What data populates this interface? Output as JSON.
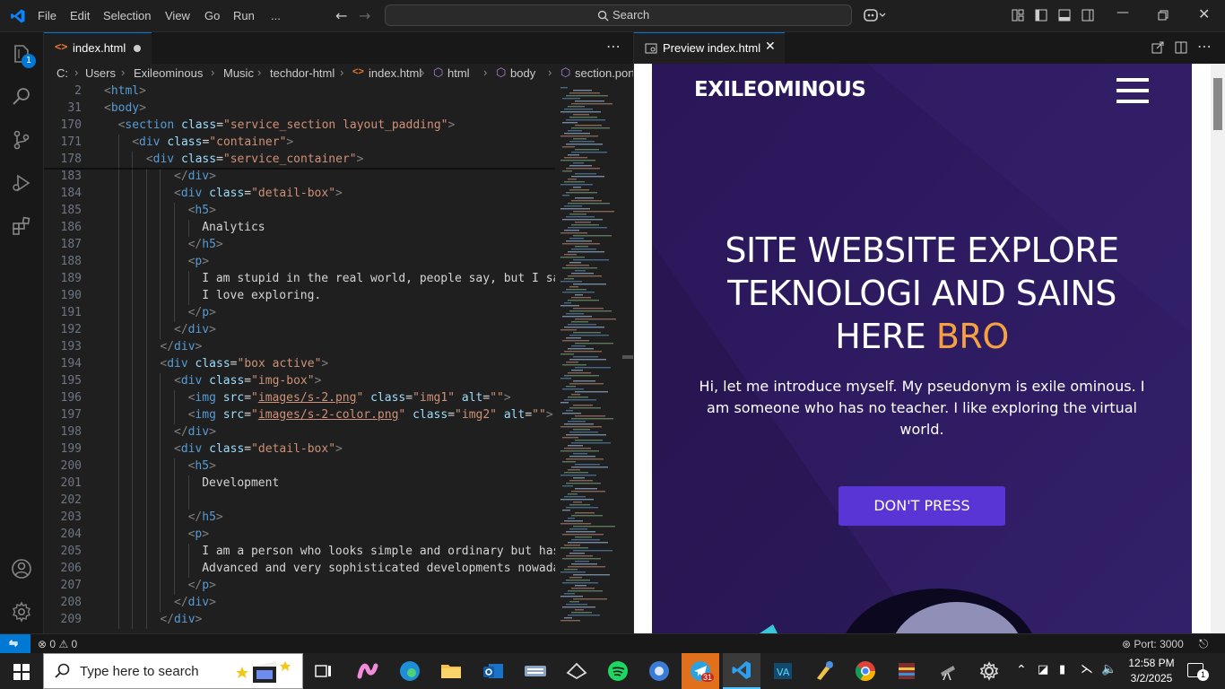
{
  "menu": [
    "File",
    "Edit",
    "Selection",
    "View",
    "Go",
    "Run",
    "..."
  ],
  "search": {
    "label": "Search"
  },
  "badge_count": "1",
  "editor_tab": {
    "title": "index.html"
  },
  "preview_tab": {
    "title": "Preview index.html"
  },
  "breadcrumbs": [
    "C:",
    "Users",
    "Exileominous",
    "Music",
    "techdor-html",
    "index.html",
    "html",
    "body",
    "section.portfolio"
  ],
  "sticky_lines": [
    {
      "n": "2",
      "indent": 0,
      "parts": [
        [
          "punc",
          "<"
        ],
        [
          "tag",
          "html"
        ],
        [
          "punc",
          ">"
        ]
      ]
    },
    {
      "n": "31",
      "indent": 0,
      "parts": [
        [
          "punc",
          "<"
        ],
        [
          "tag",
          "body"
        ],
        [
          "punc",
          ">"
        ]
      ]
    },
    {
      "n": "170",
      "indent": 1,
      "parts": [
        [
          "punc",
          "<"
        ],
        [
          "tag",
          "section"
        ],
        [
          "txt",
          " "
        ],
        [
          "attr",
          "class"
        ],
        [
          "txt",
          "="
        ],
        [
          "str",
          "\"service_section layout_padding\""
        ],
        [
          "punc",
          ">"
        ]
      ]
    },
    {
      "n": "171",
      "indent": 2,
      "parts": [
        [
          "punc",
          "<"
        ],
        [
          "tag",
          "div"
        ],
        [
          "txt",
          " "
        ],
        [
          "attr",
          "class"
        ],
        [
          "txt",
          "="
        ],
        [
          "str",
          "\"container\""
        ],
        [
          "punc",
          ">"
        ]
      ]
    },
    {
      "n": "178",
      "indent": 3,
      "parts": [
        [
          "punc",
          "<"
        ],
        [
          "tag",
          "div"
        ],
        [
          "txt",
          " "
        ],
        [
          "attr",
          "class"
        ],
        [
          "txt",
          "="
        ],
        [
          "str",
          "\"service_container\""
        ],
        [
          "punc",
          ">"
        ]
      ]
    }
  ],
  "code_lines": [
    {
      "n": "183",
      "indent": 5,
      "parts": [
        [
          "punc",
          "</"
        ],
        [
          "tag",
          "div"
        ],
        [
          "punc",
          ">"
        ]
      ]
    },
    {
      "n": "184",
      "indent": 5,
      "parts": [
        [
          "punc",
          "<"
        ],
        [
          "tag",
          "div"
        ],
        [
          "txt",
          " "
        ],
        [
          "attr",
          "class"
        ],
        [
          "txt",
          "="
        ],
        [
          "str",
          "\"detail-box\""
        ],
        [
          "punc",
          ">"
        ]
      ]
    },
    {
      "n": "185",
      "indent": 6,
      "parts": [
        [
          "punc",
          "<"
        ],
        [
          "tag",
          "h5"
        ],
        [
          "punc",
          ">"
        ]
      ]
    },
    {
      "n": "186",
      "indent": 7,
      "parts": [
        [
          "txt",
          "Analytics"
        ]
      ]
    },
    {
      "n": "187",
      "indent": 6,
      "parts": [
        [
          "punc",
          "</"
        ],
        [
          "tag",
          "h5"
        ],
        [
          "punc",
          ">"
        ]
      ]
    },
    {
      "n": "188",
      "indent": 6,
      "parts": [
        [
          "punc",
          "<"
        ],
        [
          "tag",
          "p"
        ],
        [
          "punc",
          ">"
        ]
      ]
    },
    {
      "n": "189",
      "indent": 7,
      "parts": [
        [
          "txt",
          "I am stupid in the real world, people say, but I say"
        ]
      ]
    },
    {
      "n": "190",
      "indent": 7,
      "parts": [
        [
          "txt",
          "I love exploring."
        ]
      ]
    },
    {
      "n": "191",
      "indent": 6,
      "parts": [
        [
          "punc",
          "</"
        ],
        [
          "tag",
          "p"
        ],
        [
          "punc",
          ">"
        ]
      ]
    },
    {
      "n": "192",
      "indent": 5,
      "parts": [
        [
          "punc",
          "</"
        ],
        [
          "tag",
          "div"
        ],
        [
          "punc",
          ">"
        ]
      ]
    },
    {
      "n": "193",
      "indent": 4,
      "parts": [
        [
          "punc",
          "</"
        ],
        [
          "tag",
          "div"
        ],
        [
          "punc",
          ">"
        ]
      ]
    },
    {
      "n": "194",
      "indent": 4,
      "parts": [
        [
          "punc",
          "<"
        ],
        [
          "tag",
          "div"
        ],
        [
          "txt",
          " "
        ],
        [
          "attr",
          "class"
        ],
        [
          "txt",
          "="
        ],
        [
          "str",
          "\"box active\""
        ],
        [
          "punc",
          ">"
        ]
      ]
    },
    {
      "n": "195",
      "indent": 5,
      "parts": [
        [
          "punc",
          "<"
        ],
        [
          "tag",
          "div"
        ],
        [
          "txt",
          " "
        ],
        [
          "attr",
          "class"
        ],
        [
          "txt",
          "="
        ],
        [
          "str",
          "\"img-box\""
        ],
        [
          "punc",
          ">"
        ]
      ]
    },
    {
      "n": "196",
      "indent": 6,
      "parts": [
        [
          "punc",
          "<"
        ],
        [
          "tag",
          "img"
        ],
        [
          "txt",
          " "
        ],
        [
          "attr",
          "src"
        ],
        [
          "txt",
          "="
        ],
        [
          "str",
          "\""
        ],
        [
          "lnk",
          "images/s-2.png"
        ],
        [
          "str",
          "\""
        ],
        [
          "txt",
          " "
        ],
        [
          "attr",
          "class"
        ],
        [
          "txt",
          "="
        ],
        [
          "str",
          "\"img1\""
        ],
        [
          "txt",
          " "
        ],
        [
          "attr",
          "alt"
        ],
        [
          "txt",
          "="
        ],
        [
          "str",
          "\"\""
        ],
        [
          "punc",
          ">"
        ]
      ]
    },
    {
      "n": "197",
      "indent": 6,
      "parts": [
        [
          "punc",
          "<"
        ],
        [
          "tag",
          "img"
        ],
        [
          "txt",
          " "
        ],
        [
          "attr",
          "src"
        ],
        [
          "txt",
          "="
        ],
        [
          "str",
          "\""
        ],
        [
          "lnk",
          "images/s-2-color.png"
        ],
        [
          "str",
          "\""
        ],
        [
          "txt",
          " "
        ],
        [
          "attr",
          "class"
        ],
        [
          "txt",
          "="
        ],
        [
          "str",
          "\"img2\""
        ],
        [
          "txt",
          " "
        ],
        [
          "attr",
          "alt"
        ],
        [
          "txt",
          "="
        ],
        [
          "str",
          "\"\""
        ],
        [
          "punc",
          ">"
        ]
      ]
    },
    {
      "n": "198",
      "indent": 5,
      "parts": [
        [
          "punc",
          "</"
        ],
        [
          "tag",
          "div"
        ],
        [
          "punc",
          ">"
        ]
      ]
    },
    {
      "n": "199",
      "indent": 5,
      "parts": [
        [
          "punc",
          "<"
        ],
        [
          "tag",
          "div"
        ],
        [
          "txt",
          " "
        ],
        [
          "attr",
          "class"
        ],
        [
          "txt",
          "="
        ],
        [
          "str",
          "\"detail-box\""
        ],
        [
          "punc",
          ">"
        ]
      ]
    },
    {
      "n": "200",
      "indent": 6,
      "parts": [
        [
          "punc",
          "<"
        ],
        [
          "tag",
          "h5"
        ],
        [
          "punc",
          ">"
        ]
      ]
    },
    {
      "n": "201",
      "indent": 7,
      "parts": [
        [
          "txt",
          "Development"
        ]
      ]
    },
    {
      "n": "202",
      "indent": 7,
      "parts": []
    },
    {
      "n": "203",
      "indent": 6,
      "parts": [
        [
          "punc",
          "</"
        ],
        [
          "tag",
          "h5"
        ],
        [
          "punc",
          ">"
        ]
      ]
    },
    {
      "n": "204",
      "indent": 6,
      "parts": [
        [
          "punc",
          "<"
        ],
        [
          "tag",
          "p"
        ],
        [
          "punc",
          ">"
        ]
      ]
    },
    {
      "n": "205",
      "indent": 7,
      "parts": [
        [
          "txt",
          "I am a person who looks simple and ordinary but has"
        ]
      ]
    },
    {
      "n": "206",
      "indent": 7,
      "parts": [
        [
          "txt",
          "Advanced and very sophisticated developments nowadays"
        ]
      ]
    },
    {
      "n": "207",
      "indent": 6,
      "parts": [
        [
          "punc",
          "</"
        ],
        [
          "tag",
          "p"
        ],
        [
          "punc",
          ">"
        ]
      ]
    },
    {
      "n": "208",
      "indent": 5,
      "parts": [
        [
          "punc",
          "</"
        ],
        [
          "tag",
          "div"
        ],
        [
          "punc",
          ">"
        ]
      ]
    },
    {
      "n": "209",
      "indent": 4,
      "parts": [
        [
          "punc",
          "</"
        ],
        [
          "tag",
          "div"
        ],
        [
          "punc",
          ">"
        ]
      ]
    }
  ],
  "site": {
    "brand": "EXILEOMINOUS",
    "headline_lines": [
      "SITE WEBSITE EXPLORE",
      "TEKNOLOGI AND SAINS"
    ],
    "headline_last": "HERE ",
    "headline_accent": "BRO",
    "intro_lines": [
      "Hi, let me introduce myself. My pseudonym is exile ominous. I",
      "am someone who has no teacher. I like exploring the virtual",
      "world."
    ],
    "button": "DON'T PRESS",
    "accent_color": "#f5a142",
    "button_color": "#5a35d6"
  },
  "status": {
    "errors": "0",
    "warnings": "0",
    "port": "Port: 3000"
  },
  "taskbar": {
    "search_placeholder": "Type here to search",
    "time": "12:58 PM",
    "date": "3/2/2025",
    "telegram_badge": "31",
    "notif_count": "1"
  },
  "colors": {
    "vscode_blue": "#0078d4",
    "editor_bg": "#1f1f1f"
  }
}
